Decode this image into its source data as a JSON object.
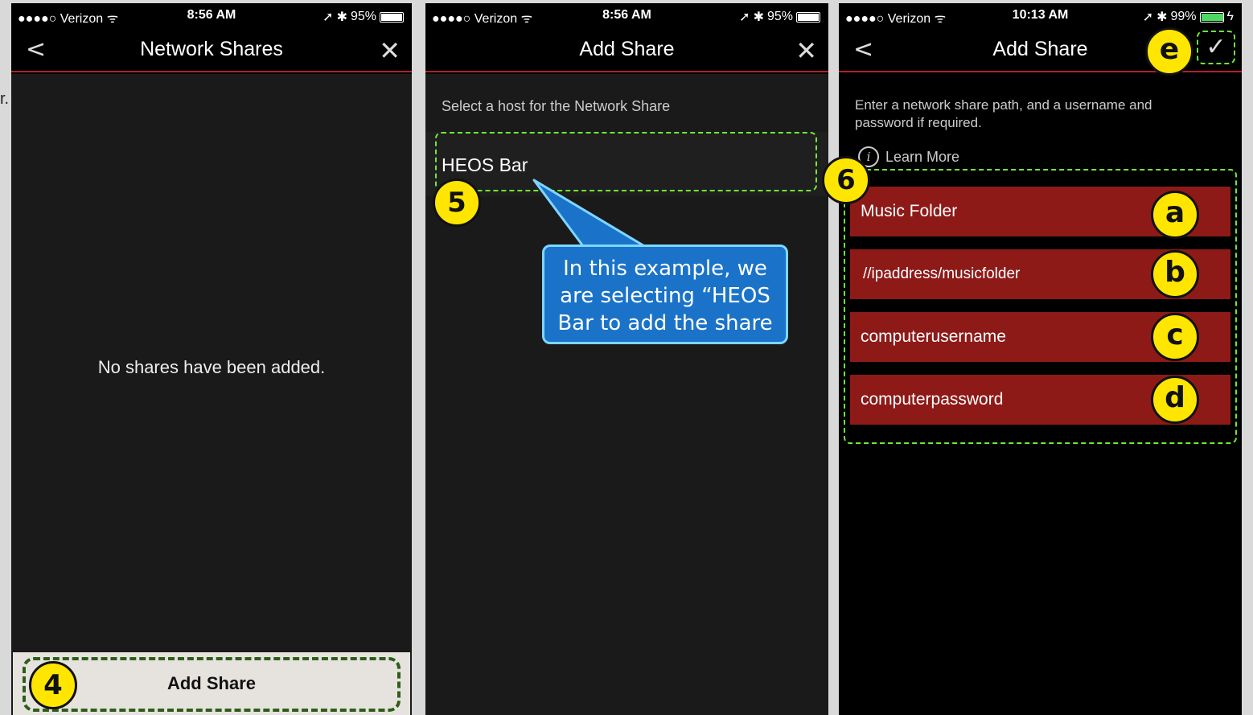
{
  "edge_text": "r.",
  "status": {
    "screen1": {
      "carrier": "●●●●○ Verizon ᯤ",
      "time": "8:56 AM",
      "battery": "95%"
    },
    "screen2": {
      "carrier": "●●●●○ Verizon ᯤ",
      "time": "8:56 AM",
      "battery": "95%"
    },
    "screen3": {
      "carrier": "●●●●○ Verizon ᯤ",
      "time": "10:13 AM",
      "battery": "99%"
    }
  },
  "screen1": {
    "title": "Network Shares",
    "empty_message": "No shares have been added.",
    "add_button": "Add Share"
  },
  "screen2": {
    "title": "Add Share",
    "hint": "Select a host for the Network Share",
    "host": "HEOS Bar",
    "callout": "In this example, we are selecting “HEOS Bar to add the share"
  },
  "screen3": {
    "title": "Add Share",
    "description": "Enter a network share path, and a username and password if required.",
    "learn_more": "Learn More",
    "fields": {
      "name": "Music Folder",
      "path": "//ipaddress/musicfolder",
      "username": "computerusername",
      "password": "computerpassword"
    }
  },
  "markers": {
    "m4": "4",
    "m5": "5",
    "m6": "6",
    "a": "a",
    "b": "b",
    "c": "c",
    "d": "d",
    "e": "e"
  },
  "colors": {
    "accent_red": "#b3202a",
    "field_red": "#8e1a18",
    "highlight_green": "#6eea3a",
    "marker_yellow": "#ffe600",
    "callout_blue": "#1a73c8"
  }
}
